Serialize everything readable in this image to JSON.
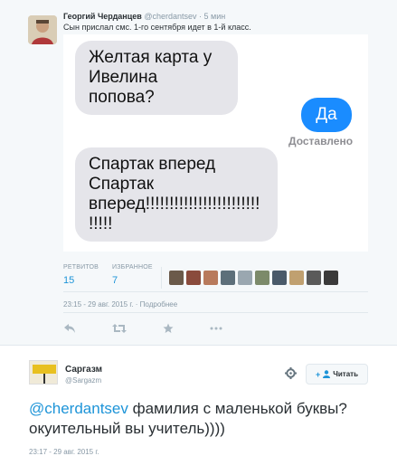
{
  "tweet": {
    "author_name": "Георгий Черданцев",
    "author_handle": "@cherdantsev",
    "time": "· 5 мин",
    "text": "Сын прислал смс. 1-го сентября идет в 1-й класс.",
    "messages": {
      "incoming_1": "Желтая карта у Ивелина попова?",
      "outgoing": "Да",
      "delivered": "Доставлено",
      "incoming_2": "Спартак вперед Спартак вперед!!!!!!!!!!!!!!!!!!!!!!!!!!!!!"
    },
    "stats": {
      "retweets_label": "РЕТВИТОВ",
      "retweets": "15",
      "favorites_label": "ИЗБРАННОЕ",
      "favorites": "7"
    },
    "timestamp": "23:15 - 29 авг. 2015 г.",
    "details_link": "Подробнее",
    "separator": "·",
    "face_colors": [
      "#6b5a4a",
      "#8a4b3c",
      "#b87a5c",
      "#5d6f7a",
      "#9aa7b0",
      "#7c8a6a",
      "#4a5a6a",
      "#c0a070",
      "#5a5a5a",
      "#3a3a3a"
    ]
  },
  "reply": {
    "author_name": "Саргазм",
    "author_handle": "@Sargazm",
    "follow_label": "Читать",
    "follow_plus": "+",
    "mention": "@cherdantsev",
    "text": " фамилия с маленькой буквы? окуительный вы учитель))))",
    "timestamp": "23:17 - 29 авг. 2015 г."
  },
  "icons": [
    "reply-icon",
    "retweet-icon",
    "favorite-icon",
    "more-icon",
    "gear-icon",
    "add-user-icon"
  ],
  "colors": {
    "accent": "#1d94d8",
    "imessage_blue": "#1a8cff",
    "bubble_gray": "#e5e5ea",
    "panel_bg": "#f5f8fa"
  }
}
